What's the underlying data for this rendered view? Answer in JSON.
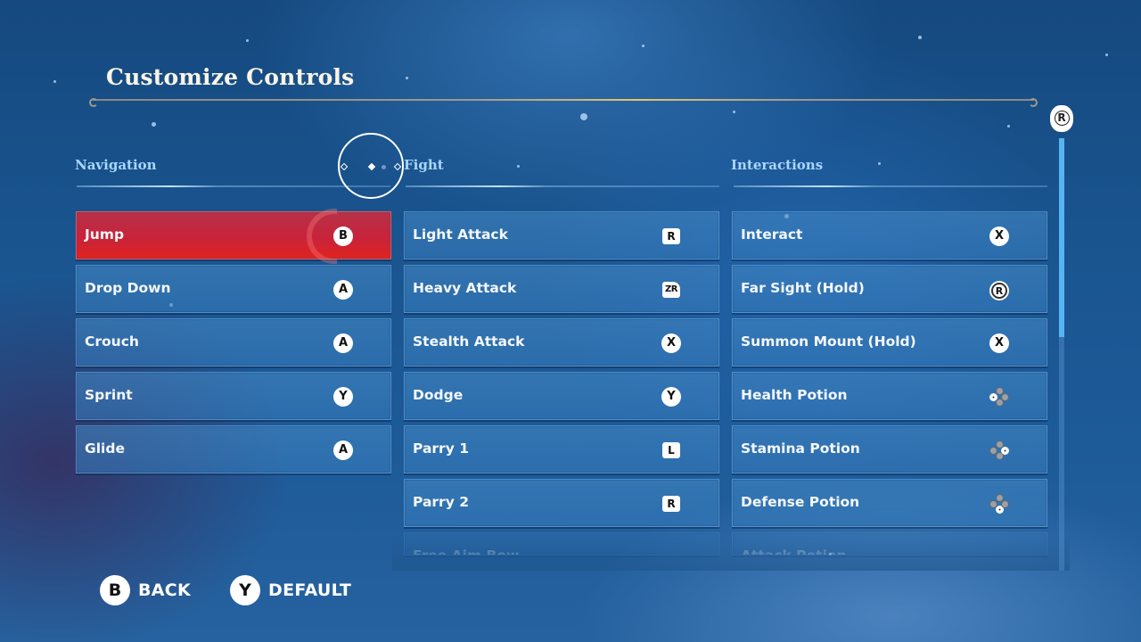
{
  "title": "Customize Controls",
  "scroll": {
    "badge_label": "R",
    "thumb_fraction": 0.46,
    "position_fraction": 0.0
  },
  "columns": [
    {
      "header": "Navigation",
      "rows": [
        {
          "label": "Jump",
          "button": "B",
          "icon": "b-button-icon",
          "style": "circle",
          "selected": true
        },
        {
          "label": "Drop Down",
          "button": "A",
          "icon": "a-button-icon",
          "style": "circle"
        },
        {
          "label": "Crouch",
          "button": "A",
          "icon": "a-button-icon",
          "style": "circle"
        },
        {
          "label": "Sprint",
          "button": "Y",
          "icon": "y-button-icon",
          "style": "circle"
        },
        {
          "label": "Glide",
          "button": "A",
          "icon": "a-button-icon",
          "style": "circle"
        }
      ]
    },
    {
      "header": "Fight",
      "rows": [
        {
          "label": "Light Attack",
          "button": "R",
          "icon": "r-shoulder-icon",
          "style": "square"
        },
        {
          "label": "Heavy Attack",
          "button": "ZR",
          "icon": "zr-trigger-icon",
          "style": "zr"
        },
        {
          "label": "Stealth Attack",
          "button": "X",
          "icon": "x-button-icon",
          "style": "circle"
        },
        {
          "label": "Dodge",
          "button": "Y",
          "icon": "y-button-icon",
          "style": "circle"
        },
        {
          "label": "Parry 1",
          "button": "L",
          "icon": "l-shoulder-icon",
          "style": "square"
        },
        {
          "label": "Parry 2",
          "button": "R",
          "icon": "r-shoulder-icon",
          "style": "square"
        },
        {
          "label": "Free Aim Bow",
          "button": "",
          "icon": "zl-trigger-icon",
          "style": "faded"
        }
      ]
    },
    {
      "header": "Interactions",
      "rows": [
        {
          "label": "Interact",
          "button": "X",
          "icon": "x-button-icon",
          "style": "circle"
        },
        {
          "label": "Far Sight (Hold)",
          "button": "R",
          "icon": "right-stick-press-icon",
          "style": "stick"
        },
        {
          "label": "Summon Mount (Hold)",
          "button": "X",
          "icon": "x-button-icon",
          "style": "circle"
        },
        {
          "label": "Health Potion",
          "button": "",
          "icon": "dpad-left-icon",
          "style": "dpad",
          "dir": "l"
        },
        {
          "label": "Stamina Potion",
          "button": "",
          "icon": "dpad-right-icon",
          "style": "dpad",
          "dir": "r"
        },
        {
          "label": "Defense Potion",
          "button": "",
          "icon": "dpad-down-icon",
          "style": "dpad",
          "dir": "d"
        },
        {
          "label": "Attack Potion",
          "button": "",
          "icon": "dpad-up-icon",
          "style": "faded"
        }
      ]
    }
  ],
  "footer": {
    "back": {
      "button": "B",
      "label": "BACK"
    },
    "default": {
      "button": "Y",
      "label": "DEFAULT"
    }
  }
}
